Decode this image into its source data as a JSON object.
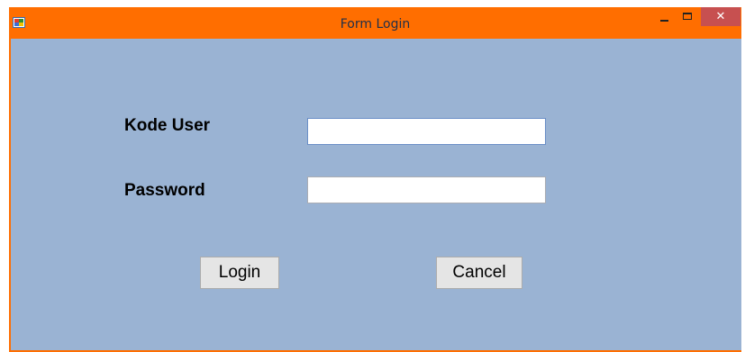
{
  "window": {
    "title": "Form Login",
    "close_glyph": "✕",
    "icon": "app-form-icon",
    "titlebar_color": "#ff6e00",
    "client_color": "#9ab3d3",
    "close_color": "#c75050"
  },
  "form": {
    "kode_user_label": "Kode User",
    "kode_user_value": "",
    "password_label": "Password",
    "password_value": "",
    "login_label": "Login",
    "cancel_label": "Cancel"
  }
}
